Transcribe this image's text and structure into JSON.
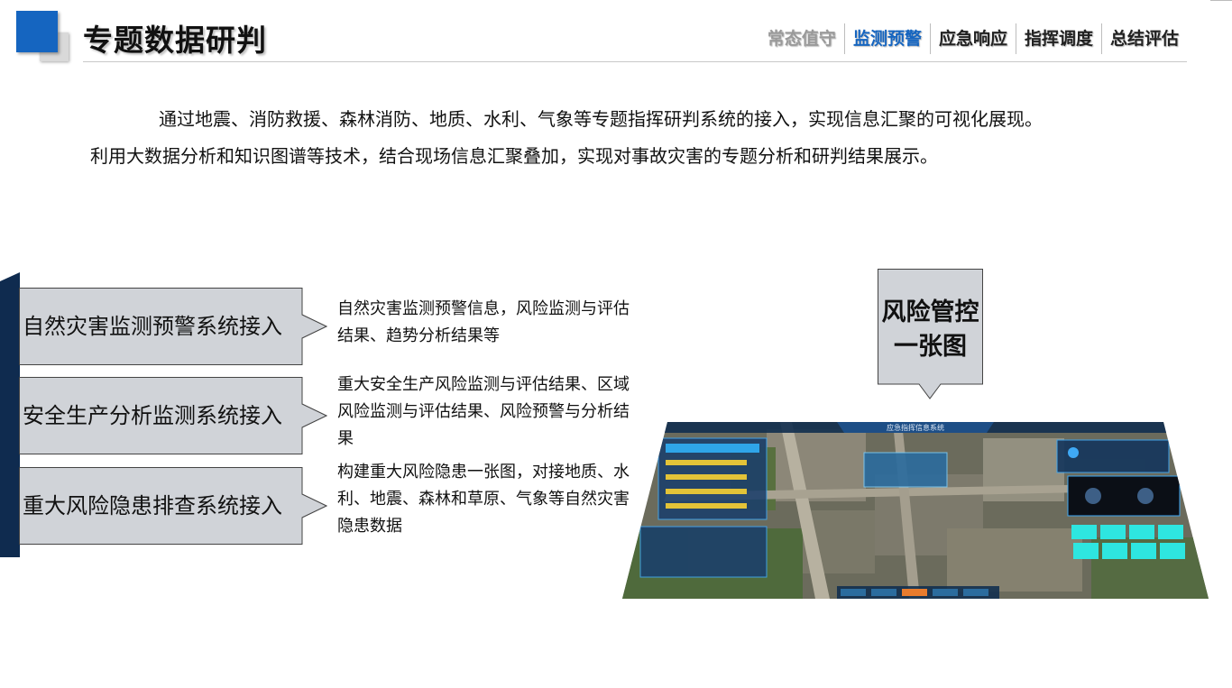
{
  "header": {
    "title": "专题数据研判",
    "tabs": [
      {
        "label": "常态值守",
        "state": "dim"
      },
      {
        "label": "监测预警",
        "state": "active"
      },
      {
        "label": "应急响应",
        "state": "normal"
      },
      {
        "label": "指挥调度",
        "state": "normal"
      },
      {
        "label": "总结评估",
        "state": "normal"
      }
    ]
  },
  "intro": {
    "line1": "通过地震、消防救援、森林消防、地质、水利、气象等专题指挥研判系统的接入，实现信息汇聚的可视化展现。",
    "line2": "利用大数据分析和知识图谱等技术，结合现场信息汇聚叠加，实现对事故灾害的专题分析和研判结果展示。"
  },
  "systems": [
    {
      "label": "自然灾害监测预警系统接入",
      "desc": "自然灾害监测预警信息，风险监测与评估结果、趋势分析结果等"
    },
    {
      "label": "安全生产分析监测系统接入",
      "desc": "重大安全生产风险监测与评估结果、区域风险监测与评估结果、风险预警与分析结果"
    },
    {
      "label": "重大风险隐患排查系统接入",
      "desc": "构建重大风险隐患一张图，对接地质、水利、地震、森林和草原、气象等自然灾害隐患数据"
    }
  ],
  "callout": {
    "line1": "风险管控",
    "line2": "一张图"
  },
  "map": {
    "title": "应急指挥信息系统"
  },
  "colors": {
    "accent": "#1565c0",
    "dark_bar": "#0f2b4f",
    "box_fill": "#d0d3d8",
    "panel_cyan": "#2ee6e0"
  }
}
